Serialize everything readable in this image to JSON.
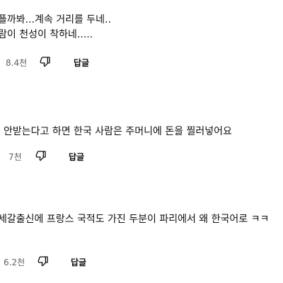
{
  "comments": [
    {
      "lines": [
        "플까봐...계속 거리를 두네..",
        "람이 천성이 착하네....."
      ],
      "like_count": "8.4천",
      "reply_label": "답글"
    },
    {
      "lines": [
        "안받는다고 하면 한국 사람은 주머니에 돈을 찔러넣어요"
      ],
      "like_count": "7천",
      "reply_label": "답글"
    },
    {
      "lines": [
        "세갈출신에 프랑스 국적도 가진 두분이 파리에서 왜 한국어로 ㅋㅋ"
      ],
      "like_count": "6.2천",
      "reply_label": "답글"
    }
  ],
  "icons": {
    "dislike": "thumbs-down-icon"
  }
}
